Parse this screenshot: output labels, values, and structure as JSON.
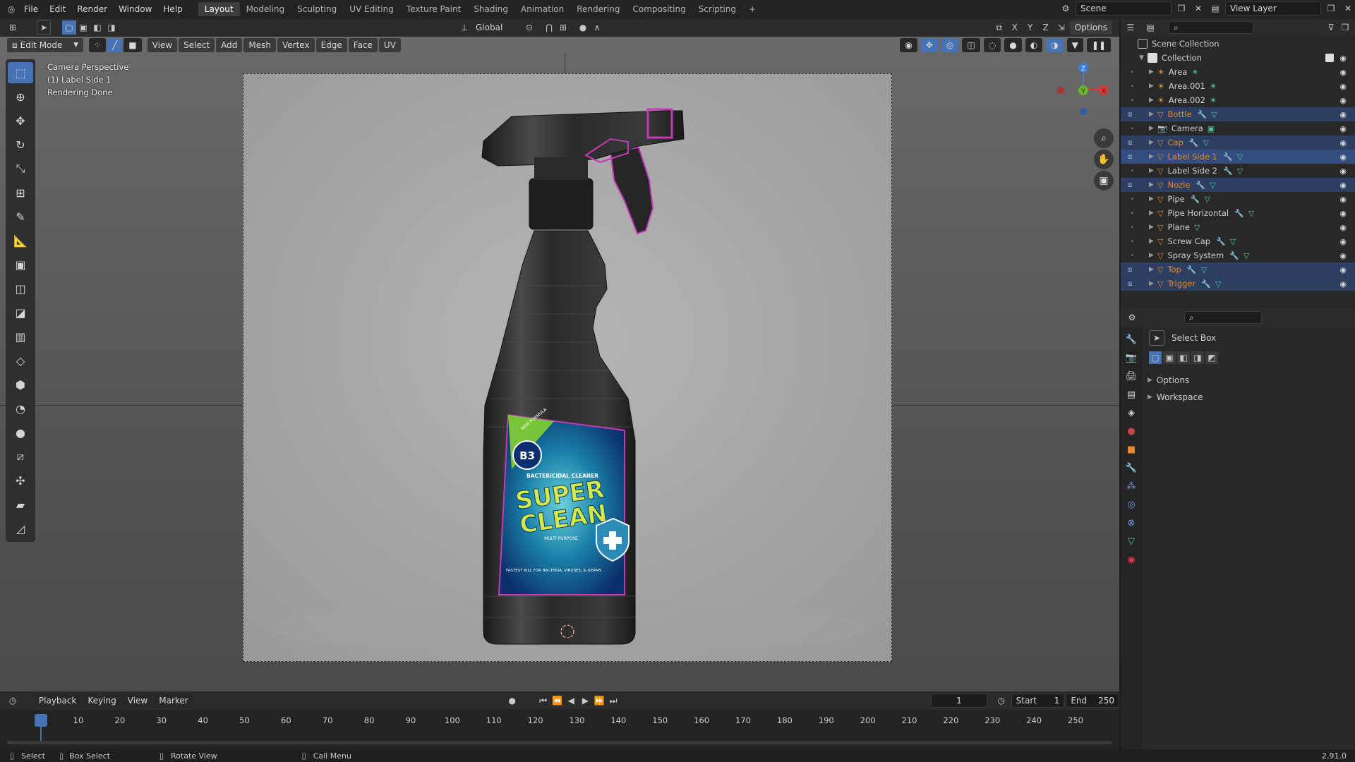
{
  "menu": [
    "File",
    "Edit",
    "Render",
    "Window",
    "Help"
  ],
  "workspaces": [
    "Layout",
    "Modeling",
    "Sculpting",
    "UV Editing",
    "Texture Paint",
    "Shading",
    "Animation",
    "Rendering",
    "Compositing",
    "Scripting"
  ],
  "scene_name": "Scene",
  "view_layer": "View Layer",
  "transform_orientation": "Global",
  "options_label": "Options",
  "mode": "Edit Mode",
  "viewport_menus": [
    "View",
    "Select",
    "Add",
    "Mesh",
    "Vertex",
    "Edge",
    "Face",
    "UV"
  ],
  "axis_toggles": [
    "X",
    "Y",
    "Z"
  ],
  "overlay": {
    "line1": "Camera Perspective",
    "line2": "(1) Label Side 1",
    "line3": "Rendering Done"
  },
  "gizmo": {
    "z": "Z",
    "y": "Y",
    "x": "X"
  },
  "label_art": {
    "badge": "B3",
    "tag": "NEW FORMULA",
    "subtitle": "BACTERICIDAL CLEANER",
    "brand1": "SUPER",
    "brand2": "CLEAN",
    "sub2": "MULTI PURPOSE",
    "footer": "FASTEST KILL FOR BACTERIA, VIRUSES, & GERMS"
  },
  "outliner": {
    "root": "Scene Collection",
    "collection": "Collection",
    "items": [
      {
        "name": "Area",
        "type": "light",
        "sel": false
      },
      {
        "name": "Area.001",
        "type": "light",
        "sel": false
      },
      {
        "name": "Area.002",
        "type": "light",
        "sel": false
      },
      {
        "name": "Bottle",
        "type": "mesh",
        "sel": true
      },
      {
        "name": "Camera",
        "type": "camera",
        "sel": false
      },
      {
        "name": "Cap",
        "type": "mesh",
        "sel": true
      },
      {
        "name": "Label Side 1",
        "type": "mesh",
        "sel": true,
        "active": true
      },
      {
        "name": "Label Side 2",
        "type": "mesh",
        "sel": false
      },
      {
        "name": "Nozle",
        "type": "mesh",
        "sel": true
      },
      {
        "name": "Pipe",
        "type": "mesh",
        "sel": false
      },
      {
        "name": "Pipe Horizontal",
        "type": "mesh",
        "sel": false
      },
      {
        "name": "Plane",
        "type": "mesh",
        "sel": false
      },
      {
        "name": "Screw Cap",
        "type": "mesh",
        "sel": false
      },
      {
        "name": "Spray System",
        "type": "mesh",
        "sel": false
      },
      {
        "name": "Top",
        "type": "mesh",
        "sel": true
      },
      {
        "name": "Trigger",
        "type": "mesh",
        "sel": true
      }
    ]
  },
  "properties": {
    "tool": "Select Box",
    "panels": [
      "Options",
      "Workspace"
    ]
  },
  "timeline": {
    "menus": [
      "Playback",
      "Keying",
      "View",
      "Marker"
    ],
    "current_frame": "1",
    "start_label": "Start",
    "start": "1",
    "end_label": "End",
    "end": "250",
    "ticks": [
      "1",
      "10",
      "20",
      "30",
      "40",
      "50",
      "60",
      "70",
      "80",
      "90",
      "100",
      "110",
      "120",
      "130",
      "140",
      "150",
      "160",
      "170",
      "180",
      "190",
      "200",
      "210",
      "220",
      "230",
      "240",
      "250"
    ]
  },
  "status": {
    "select": "Select",
    "box_select": "Box Select",
    "rotate": "Rotate View",
    "call_menu": "Call Menu",
    "version": "2.91.0"
  },
  "colors": {
    "accent": "#4772b3",
    "selected_obj": "#e7892a",
    "edit_select": "#c43ab8"
  }
}
